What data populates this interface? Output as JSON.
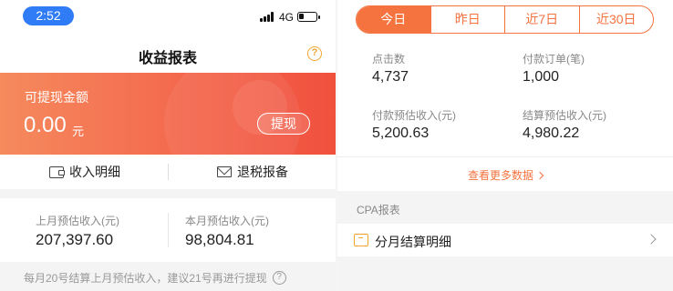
{
  "status": {
    "time": "2:52",
    "network": "4G"
  },
  "header": {
    "title": "收益报表",
    "help_glyph": "?"
  },
  "banner": {
    "label": "可提现金额",
    "amount": "0.00",
    "unit": "元",
    "withdraw_label": "提现"
  },
  "actions": {
    "income_detail": "收入明细",
    "tax_report": "退税报备"
  },
  "estimates": {
    "last_month_label": "上月预估收入(元)",
    "last_month_value": "207,397.60",
    "this_month_label": "本月预估收入(元)",
    "this_month_value": "98,804.81"
  },
  "note": {
    "text": "每月20号结算上月预估收入，建议21号再进行提现",
    "help_glyph": "?"
  },
  "period_tabs": {
    "items": [
      "今日",
      "昨日",
      "近7日",
      "近30日"
    ],
    "active": "今日"
  },
  "stats": {
    "clicks_label": "点击数",
    "clicks_value": "4,737",
    "orders_label": "付款订单(笔)",
    "orders_value": "1,000",
    "paid_income_label": "付款预估收入(元)",
    "paid_income_value": "5,200.63",
    "settled_income_label": "结算预估收入(元)",
    "settled_income_value": "4,980.22"
  },
  "more_link": "查看更多数据",
  "cpa": {
    "section_title": "CPA报表",
    "detail_label": "分月结算明细"
  },
  "colors": {
    "accent": "#f4733f",
    "banner_start": "#f58a5d",
    "banner_end": "#f0513e",
    "time_pill": "#2f7cf6",
    "help": "#f0a531"
  },
  "icons": [
    "help-icon",
    "wallet-icon",
    "mail-icon",
    "calendar-icon",
    "chevron-right-icon",
    "signal-icon",
    "battery-icon"
  ]
}
